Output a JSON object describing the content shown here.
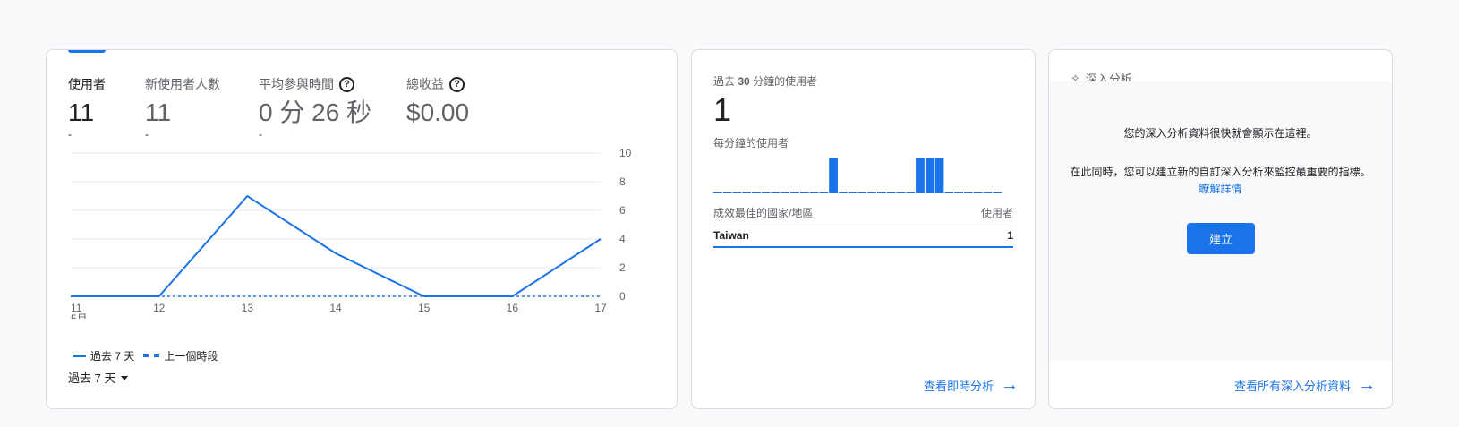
{
  "overview": {
    "metrics": [
      {
        "label": "使用者",
        "value": "11",
        "change": "-"
      },
      {
        "label": "新使用者人數",
        "value": "11",
        "change": "-"
      },
      {
        "label": "平均參與時間",
        "value": "0 分 26 秒",
        "change": "-"
      },
      {
        "label": "總收益",
        "value": "$0.00",
        "change": ""
      }
    ],
    "legend": {
      "current": "過去 7 天",
      "previous": "上一個時段"
    },
    "range_select": "過去 7 天",
    "month_label": "5月"
  },
  "chart_data": {
    "type": "line",
    "categories": [
      "11",
      "12",
      "13",
      "14",
      "15",
      "16",
      "17"
    ],
    "series": [
      {
        "name": "過去 7 天",
        "values": [
          0,
          0,
          7,
          3,
          0,
          0,
          4
        ]
      },
      {
        "name": "上一個時段",
        "values": [
          0,
          0,
          0,
          0,
          0,
          0,
          0
        ]
      }
    ],
    "yticks": [
      "0",
      "2",
      "4",
      "6",
      "8",
      "10"
    ],
    "ylim": [
      0,
      10
    ],
    "grid": true,
    "series_colors": [
      "#1a73e8",
      "#1a73e8"
    ]
  },
  "realtime": {
    "label_prefix": "過去",
    "label_bold": "30",
    "label_suffix": "分鐘的使用者",
    "value": "1",
    "per_minute_label": "每分鐘的使用者",
    "per_minute_values": [
      0,
      0,
      0,
      0,
      0,
      0,
      0,
      0,
      0,
      0,
      0,
      0,
      1,
      0,
      0,
      0,
      0,
      0,
      0,
      0,
      0,
      1,
      1,
      1,
      0,
      0,
      0,
      0,
      0,
      0
    ],
    "table_head": {
      "left": "成效最佳的國家/地區",
      "right": "使用者"
    },
    "rows": [
      {
        "country": "Taiwan",
        "users": "1"
      }
    ],
    "link": "查看即時分析"
  },
  "insights": {
    "title": "深入分析",
    "message1": "您的深入分析資料很快就會顯示在這裡。",
    "message2": "在此同時，您可以建立新的自訂深入分析來監控最重要的指標。",
    "learn_more": "瞭解詳情",
    "create_button": "建立",
    "link": "查看所有深入分析資料"
  },
  "colors": {
    "accent": "#1a73e8",
    "text": "#202124",
    "muted": "#5f6368"
  }
}
